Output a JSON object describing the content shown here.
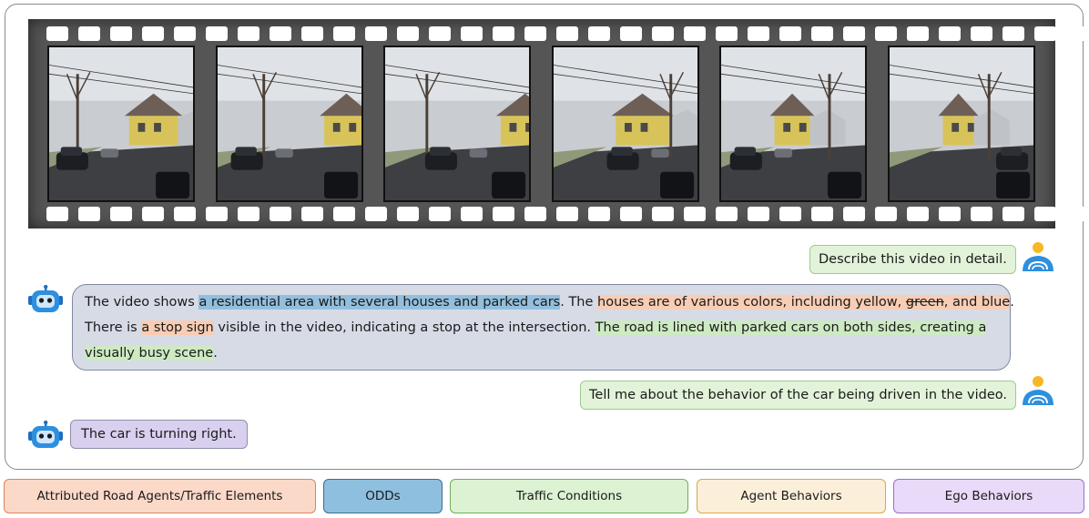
{
  "frames": [
    {
      "name": "video-frame-1"
    },
    {
      "name": "video-frame-2"
    },
    {
      "name": "video-frame-3"
    },
    {
      "name": "video-frame-4"
    },
    {
      "name": "video-frame-5"
    },
    {
      "name": "video-frame-6"
    }
  ],
  "chat": {
    "user1": "Describe this video in detail.",
    "bot1": {
      "s1": "The video shows ",
      "s2": "a residential area with several houses and parked cars",
      "s3": ". The ",
      "s4": "houses are of various colors, including yellow, ",
      "s5": "green",
      "s6": ", and blue",
      "s7": ".",
      "s8": "There is ",
      "s9": "a stop sign",
      "s10": " visible in the video, indicating a stop at the intersection. ",
      "s11": "The road is lined with parked cars on both sides, creating a",
      "s12": "visually busy scene",
      "s13": "."
    },
    "user2": "Tell me about the behavior of the car being driven in the video.",
    "bot2": "The car is turning right."
  },
  "icons": {
    "user": "user-avatar-icon",
    "bot": "robot-avatar-icon"
  },
  "legend": [
    {
      "label": "Attributed Road Agents/Traffic Elements",
      "color": "#fbd9c8"
    },
    {
      "label": "ODDs",
      "color": "#8fbfdf"
    },
    {
      "label": "Traffic Conditions",
      "color": "#dcf2d3"
    },
    {
      "label": "Agent Behaviors",
      "color": "#fcefda"
    },
    {
      "label": "Ego Behaviors",
      "color": "#e8daf8"
    }
  ]
}
